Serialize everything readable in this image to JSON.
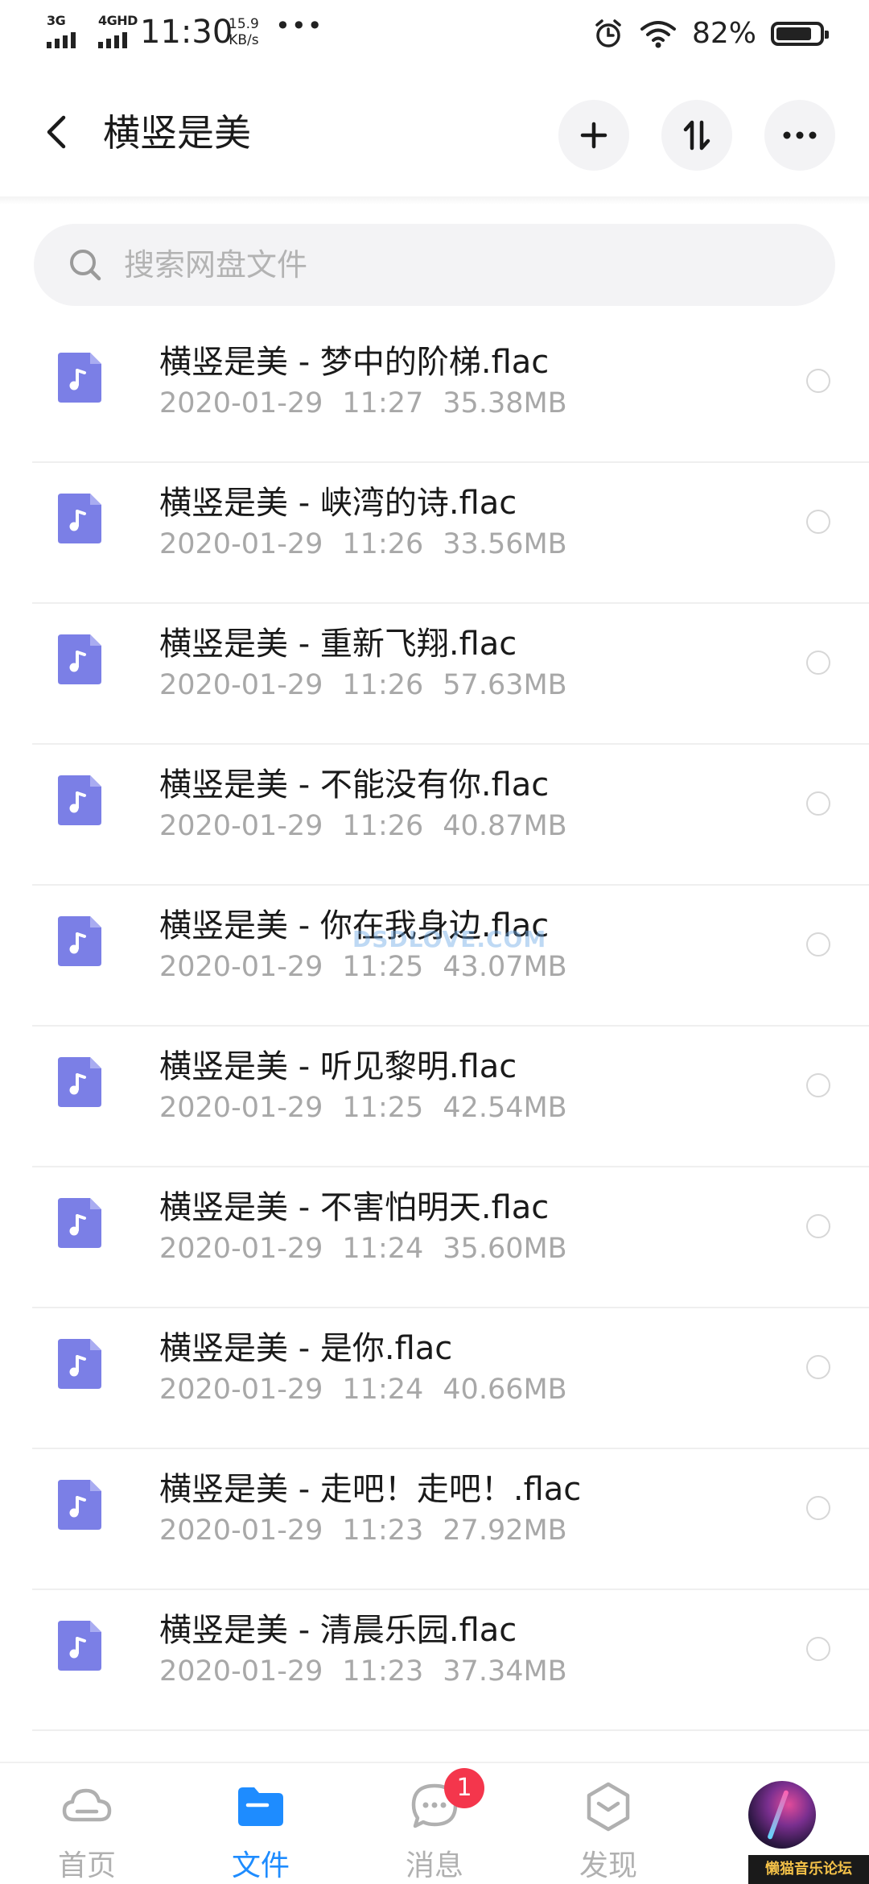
{
  "status_bar": {
    "network1": "3G",
    "network2": "4GHD",
    "time": "11:30",
    "speed_value": "15.9",
    "speed_unit": "KB/s",
    "more_dots": "•••",
    "battery_percent": "82%",
    "battery_level": 0.82,
    "icons": [
      "signal-icon",
      "alarm-icon",
      "wifi-icon",
      "battery-icon"
    ]
  },
  "header": {
    "title": "横竖是美",
    "actions": [
      "back-icon",
      "plus-icon",
      "sort-icon",
      "more-icon"
    ]
  },
  "search": {
    "placeholder": "搜索网盘文件"
  },
  "files": [
    {
      "name": "横竖是美 - 梦中的阶梯.flac",
      "date": "2020-01-29",
      "time": "11:27",
      "size": "35.38MB"
    },
    {
      "name": "横竖是美 - 峡湾的诗.flac",
      "date": "2020-01-29",
      "time": "11:26",
      "size": "33.56MB"
    },
    {
      "name": "横竖是美 - 重新飞翔.flac",
      "date": "2020-01-29",
      "time": "11:26",
      "size": "57.63MB"
    },
    {
      "name": "横竖是美 - 不能没有你.flac",
      "date": "2020-01-29",
      "time": "11:26",
      "size": "40.87MB"
    },
    {
      "name": "横竖是美 - 你在我身边.flac",
      "date": "2020-01-29",
      "time": "11:25",
      "size": "43.07MB"
    },
    {
      "name": "横竖是美 - 听见黎明.flac",
      "date": "2020-01-29",
      "time": "11:25",
      "size": "42.54MB"
    },
    {
      "name": "横竖是美 - 不害怕明天.flac",
      "date": "2020-01-29",
      "time": "11:24",
      "size": "35.60MB"
    },
    {
      "name": "横竖是美 - 是你.flac",
      "date": "2020-01-29",
      "time": "11:24",
      "size": "40.66MB"
    },
    {
      "name": "横竖是美 - 走吧！走吧！.flac",
      "date": "2020-01-29",
      "time": "11:23",
      "size": "27.92MB"
    },
    {
      "name": "横竖是美 - 清晨乐园.flac",
      "date": "2020-01-29",
      "time": "11:23",
      "size": "37.34MB"
    }
  ],
  "watermark": "DSDLOVE.COM",
  "bottom_nav": {
    "items": [
      {
        "label": "首页",
        "icon": "cloud-icon",
        "active": false
      },
      {
        "label": "文件",
        "icon": "folder-icon",
        "active": true
      },
      {
        "label": "消息",
        "icon": "message-icon",
        "active": false,
        "badge": "1"
      },
      {
        "label": "发现",
        "icon": "discover-icon",
        "active": false
      }
    ],
    "forum_badge": "懒猫音乐论坛"
  },
  "colors": {
    "accent": "#1e8cff",
    "file_icon": "#7b7fe6",
    "badge": "#f4364c",
    "meta_text": "#a8a8a8"
  }
}
